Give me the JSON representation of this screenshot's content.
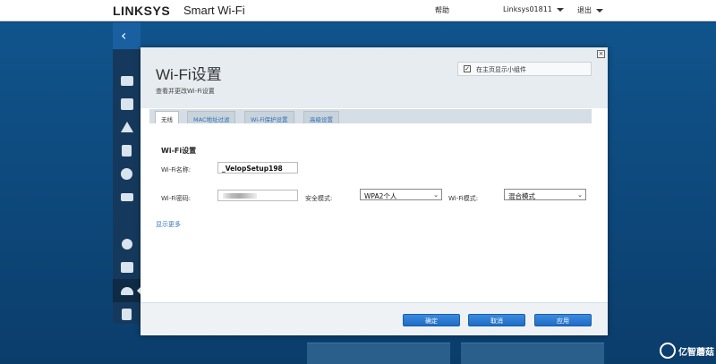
{
  "header": {
    "logo": "LINKSYS",
    "product": "Smart Wi-Fi",
    "help": "帮助",
    "user": "Linksys01811",
    "logout": "退出"
  },
  "dialog": {
    "title": "Wi-Fi设置",
    "subtitle": "查看并更改Wi-Fi设置",
    "close": "×",
    "widget_checkbox_label": "在主页显示小组件",
    "widget_checked": true,
    "tabs": [
      {
        "label": "无线",
        "active": true
      },
      {
        "label": "MAC地址过滤",
        "active": false
      },
      {
        "label": "Wi-Fi保护设置",
        "active": false
      },
      {
        "label": "高级设置",
        "active": false
      }
    ],
    "section_title": "Wi-Fi设置",
    "fields": {
      "name_label": "Wi-Fi名称:",
      "name_value": "_VelopSetup198",
      "password_label": "Wi-Fi密码:",
      "security_label": "安全模式:",
      "security_value": "WPA2个人",
      "mode_label": "Wi-Fi模式:",
      "mode_value": "混合模式"
    },
    "show_more": "显示更多",
    "buttons": {
      "ok": "确定",
      "cancel": "取消",
      "apply": "应用"
    }
  },
  "watermark": "亿智蘑菇",
  "colors": {
    "accent": "#1f6cc4",
    "background": "#0d3f6e",
    "link": "#3173b5"
  }
}
